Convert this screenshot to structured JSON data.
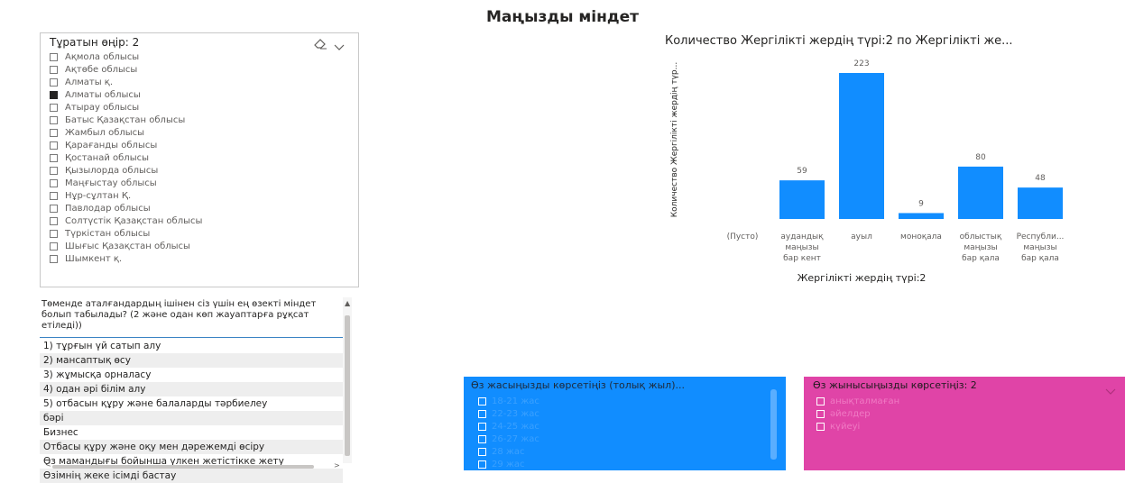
{
  "page_title": "Маңызды міндет",
  "region_slicer": {
    "header": "Тұратын өңір: 2",
    "items": [
      {
        "label": "Ақмола облысы",
        "checked": false
      },
      {
        "label": "Ақтөбе облысы",
        "checked": false
      },
      {
        "label": "Алматы қ.",
        "checked": false
      },
      {
        "label": "Алматы облысы",
        "checked": true
      },
      {
        "label": "Атырау облысы",
        "checked": false
      },
      {
        "label": "Батыс Қазақстан облысы",
        "checked": false
      },
      {
        "label": "Жамбыл облысы",
        "checked": false
      },
      {
        "label": "Қарағанды облысы",
        "checked": false
      },
      {
        "label": "Қостанай облысы",
        "checked": false
      },
      {
        "label": "Қызылорда облысы",
        "checked": false
      },
      {
        "label": "Маңғыстау облысы",
        "checked": false
      },
      {
        "label": "Нұр-сұлтан Қ.",
        "checked": false
      },
      {
        "label": "Павлодар облысы",
        "checked": false
      },
      {
        "label": "Солтүстік Қазақстан облысы",
        "checked": false
      },
      {
        "label": "Түркістан облысы",
        "checked": false
      },
      {
        "label": "Шығыс Қазақстан облысы",
        "checked": false
      },
      {
        "label": "Шымкент қ.",
        "checked": false
      }
    ],
    "icons": [
      "eraser-icon",
      "chevron-down-icon"
    ]
  },
  "question_slicer": {
    "header": "Төменде аталғандардың ішінен сіз үшін ең өзекті міндет болып табылады? (2 және одан көп жауаптарға рұқсат етіледі))",
    "items": [
      "1) тұрғын үй сатып алу",
      "2) мансаптық өсу",
      "3) жұмысқа орналасу",
      "4) одан әрі білім алу",
      "5) отбасын құру және балаларды тәрбиелеу",
      "бәрі",
      "Бизнес",
      "Отбасы құру және оқу мен дәрежемді өсіру",
      "Өз мамандығы бойынша үлкен жетістікке жету",
      "Өзімнің жеке ісімді бастау"
    ]
  },
  "chart_data": {
    "type": "bar",
    "title": "Количество Жергілікті жердің түрі:2 по Жергілікті же...",
    "xlabel": "Жергілікті жердің түрі:2",
    "ylabel": "Количество Жергілікті жердің түр...",
    "categories": [
      [
        "(Пусто)"
      ],
      [
        "аудандық",
        "маңызы",
        "бар кент"
      ],
      [
        "ауыл"
      ],
      [
        "моноқала"
      ],
      [
        "облыстық",
        "маңызы",
        "бар қала"
      ],
      [
        "Республи...",
        "маңызы",
        "бар қала"
      ]
    ],
    "values": [
      0,
      59,
      223,
      9,
      80,
      48
    ],
    "data_labels": [
      "",
      "59",
      "223",
      "9",
      "80",
      "48"
    ],
    "ylim": [
      0,
      223
    ],
    "grid": false,
    "bar_color": "#118dff"
  },
  "age_slicer": {
    "header": "Өз жасыңызды көрсетіңіз (толық жыл)...",
    "items": [
      "18-21 жас",
      "22-23 жас",
      "24-25 жас",
      "26-27 жас",
      "28 жас",
      "29 жас"
    ],
    "background": "#118dff"
  },
  "gender_slicer": {
    "header": "Өз жынысыңызды көрсетіңіз: 2",
    "items": [
      "анықталмаған",
      "әйелдер",
      "күйеуі"
    ],
    "background": "#e044a7"
  }
}
